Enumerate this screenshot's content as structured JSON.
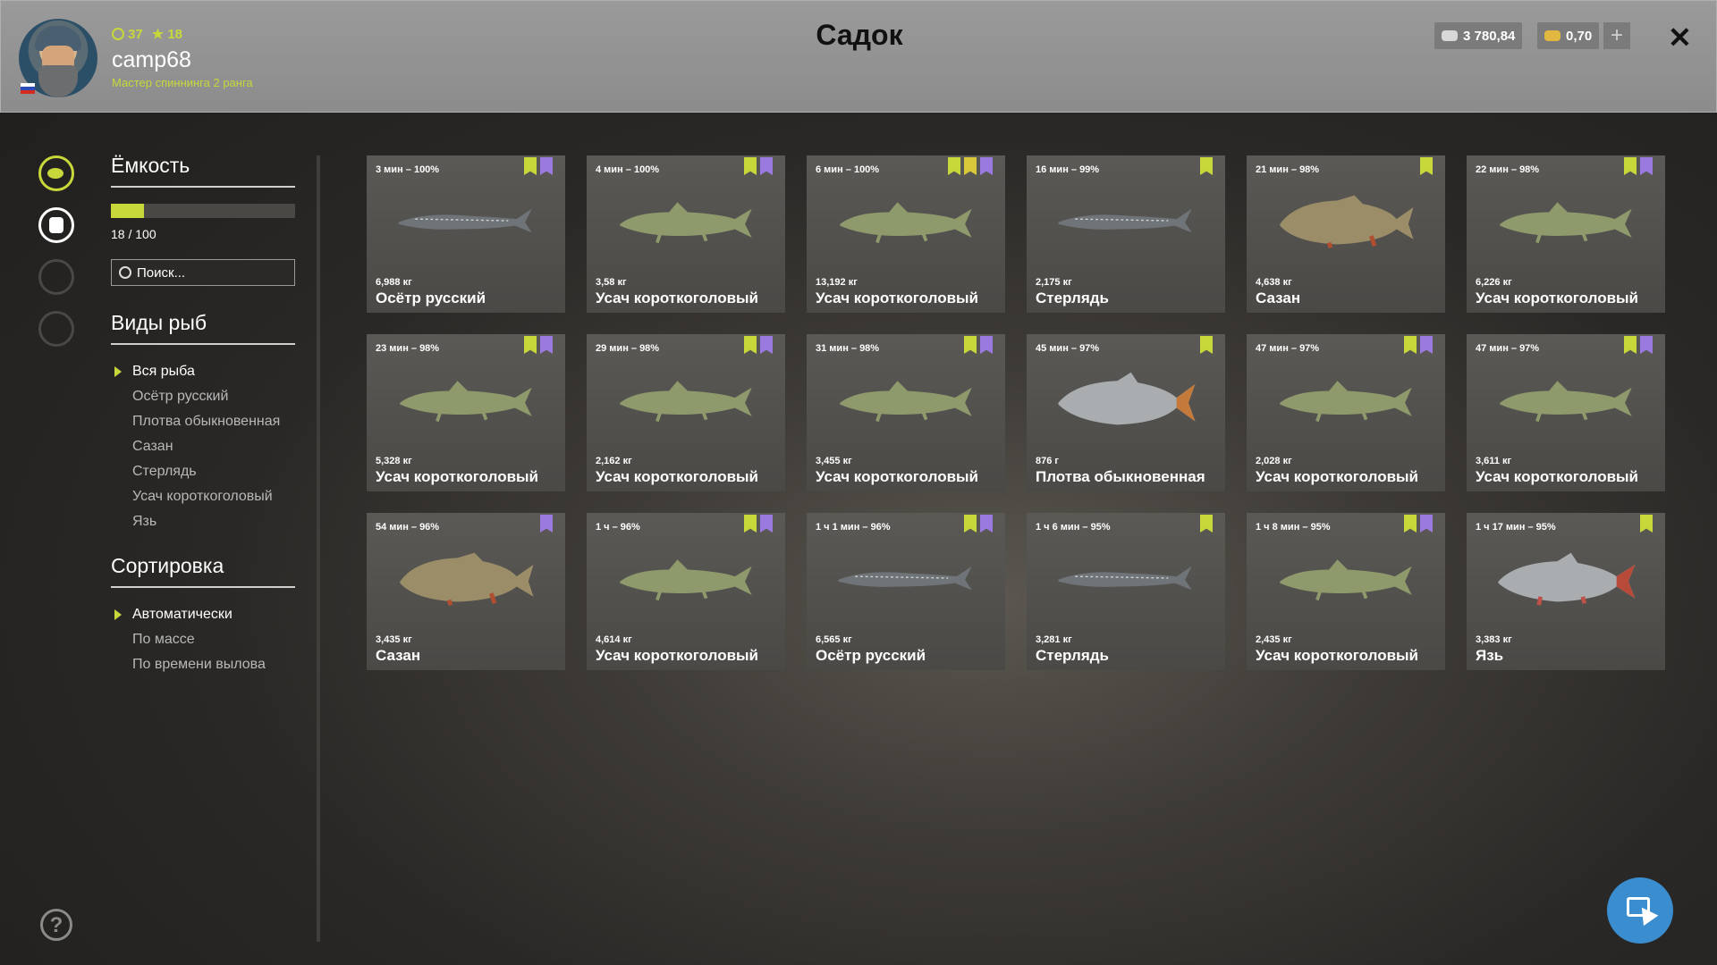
{
  "header": {
    "title": "Садок",
    "level": "37",
    "stars": "18",
    "username": "camp68",
    "rank": "Мастер спиннинга 2 ранга",
    "silver": "3 780,84",
    "gold": "0,70",
    "plus_label": "+",
    "close_label": "✕"
  },
  "sidebar": {
    "capacity_title": "Ёмкость",
    "capacity_count": "18 / 100",
    "capacity_fraction": 0.18,
    "search_placeholder": "Поиск...",
    "species_title": "Виды рыб",
    "species": [
      "Вся рыба",
      "Осётр русский",
      "Плотва обыкновенная",
      "Сазан",
      "Стерлядь",
      "Усач короткоголовый",
      "Язь"
    ],
    "sort_title": "Сортировка",
    "sort_options": [
      "Автоматически",
      "По массе",
      "По времени вылова"
    ]
  },
  "help_label": "?",
  "fish": [
    {
      "time": "3 мин – 100%",
      "weight": "6,988 кг",
      "name": "Осётр русский",
      "badges": [
        "g",
        "p"
      ],
      "color": "#6f7478",
      "shape": "sturgeon"
    },
    {
      "time": "4 мин – 100%",
      "weight": "3,58 кг",
      "name": "Усач короткоголовый",
      "badges": [
        "g",
        "p"
      ],
      "color": "#8f9a6c",
      "shape": "barbel"
    },
    {
      "time": "6 мин – 100%",
      "weight": "13,192 кг",
      "name": "Усач короткоголовый",
      "badges": [
        "g",
        "y",
        "p"
      ],
      "color": "#8f9a6c",
      "shape": "barbel"
    },
    {
      "time": "16 мин – 99%",
      "weight": "2,175 кг",
      "name": "Стерлядь",
      "badges": [
        "g"
      ],
      "color": "#6f7478",
      "shape": "sturgeon"
    },
    {
      "time": "21 мин – 98%",
      "weight": "4,638 кг",
      "name": "Сазан",
      "badges": [
        "g"
      ],
      "color": "#9a8d68",
      "shape": "carp"
    },
    {
      "time": "22 мин – 98%",
      "weight": "6,226 кг",
      "name": "Усач короткоголовый",
      "badges": [
        "g",
        "p"
      ],
      "color": "#8f9a6c",
      "shape": "barbel"
    },
    {
      "time": "23 мин – 98%",
      "weight": "5,328 кг",
      "name": "Усач короткоголовый",
      "badges": [
        "g",
        "p"
      ],
      "color": "#8f9a6c",
      "shape": "barbel"
    },
    {
      "time": "29 мин – 98%",
      "weight": "2,162 кг",
      "name": "Усач короткоголовый",
      "badges": [
        "g",
        "p"
      ],
      "color": "#8f9a6c",
      "shape": "barbel"
    },
    {
      "time": "31 мин – 98%",
      "weight": "3,455 кг",
      "name": "Усач короткоголовый",
      "badges": [
        "g",
        "p"
      ],
      "color": "#8f9a6c",
      "shape": "barbel"
    },
    {
      "time": "45 мин – 97%",
      "weight": "876 г",
      "name": "Плотва обыкновенная",
      "badges": [
        "g"
      ],
      "color": "#a9adb0",
      "shape": "roach"
    },
    {
      "time": "47 мин – 97%",
      "weight": "2,028 кг",
      "name": "Усач короткоголовый",
      "badges": [
        "g",
        "p"
      ],
      "color": "#8f9a6c",
      "shape": "barbel"
    },
    {
      "time": "47 мин – 97%",
      "weight": "3,611 кг",
      "name": "Усач короткоголовый",
      "badges": [
        "g",
        "p"
      ],
      "color": "#8f9a6c",
      "shape": "barbel"
    },
    {
      "time": "54 мин – 96%",
      "weight": "3,435 кг",
      "name": "Сазан",
      "badges": [
        "p"
      ],
      "color": "#9a8d68",
      "shape": "carp"
    },
    {
      "time": "1 ч – 96%",
      "weight": "4,614 кг",
      "name": "Усач короткоголовый",
      "badges": [
        "g",
        "p"
      ],
      "color": "#8f9a6c",
      "shape": "barbel"
    },
    {
      "time": "1 ч 1 мин – 96%",
      "weight": "6,565 кг",
      "name": "Осётр русский",
      "badges": [
        "g",
        "p"
      ],
      "color": "#6f7478",
      "shape": "sturgeon"
    },
    {
      "time": "1 ч 6 мин – 95%",
      "weight": "3,281 кг",
      "name": "Стерлядь",
      "badges": [
        "g"
      ],
      "color": "#6f7478",
      "shape": "sturgeon"
    },
    {
      "time": "1 ч 8 мин – 95%",
      "weight": "2,435 кг",
      "name": "Усач короткоголовый",
      "badges": [
        "g",
        "p"
      ],
      "color": "#8f9a6c",
      "shape": "barbel"
    },
    {
      "time": "1 ч 17 мин – 95%",
      "weight": "3,383 кг",
      "name": "Язь",
      "badges": [
        "g"
      ],
      "color": "#a9adb0",
      "shape": "ide"
    }
  ]
}
